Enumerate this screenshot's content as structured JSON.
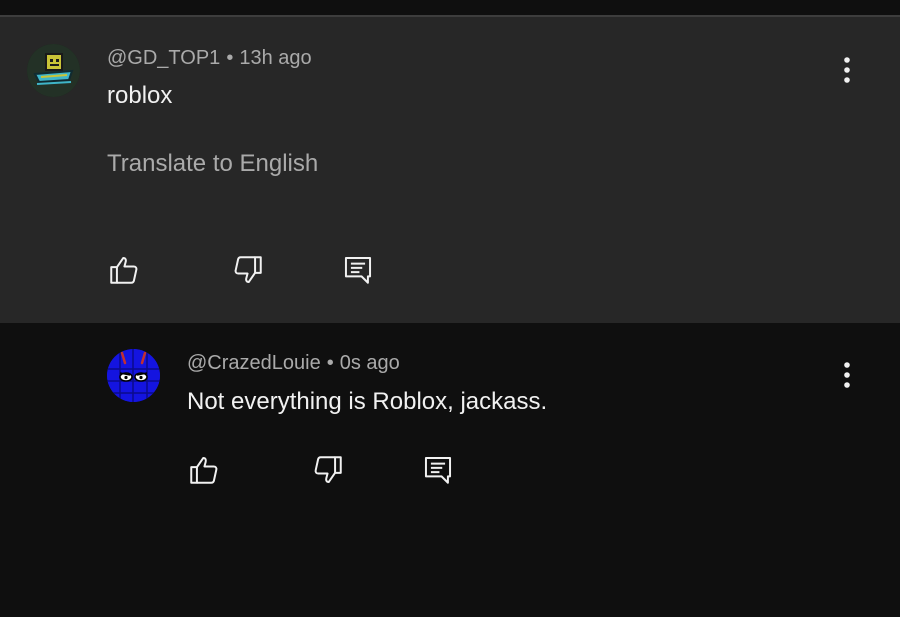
{
  "comments": [
    {
      "handle": "@GD_TOP1",
      "separator": "•",
      "time": "13h ago",
      "text": "roblox",
      "translate_label": "Translate to English",
      "avatar_icon": "geometry-dash-cube-avatar",
      "highlighted": true
    },
    {
      "handle": "@CrazedLouie",
      "separator": "•",
      "time": "0s ago",
      "text": "Not everything is Roblox, jackass.",
      "avatar_icon": "blue-devil-avatar",
      "highlighted": false
    }
  ],
  "icons": {
    "like": "thumbs-up-icon",
    "dislike": "thumbs-down-icon",
    "reply": "reply-comment-icon",
    "more": "more-vertical-icon"
  },
  "colors": {
    "highlight_bg": "#272727",
    "page_bg": "#0f0f0f",
    "meta_text": "#aaaaaa",
    "primary_text": "#f1f1f1"
  }
}
